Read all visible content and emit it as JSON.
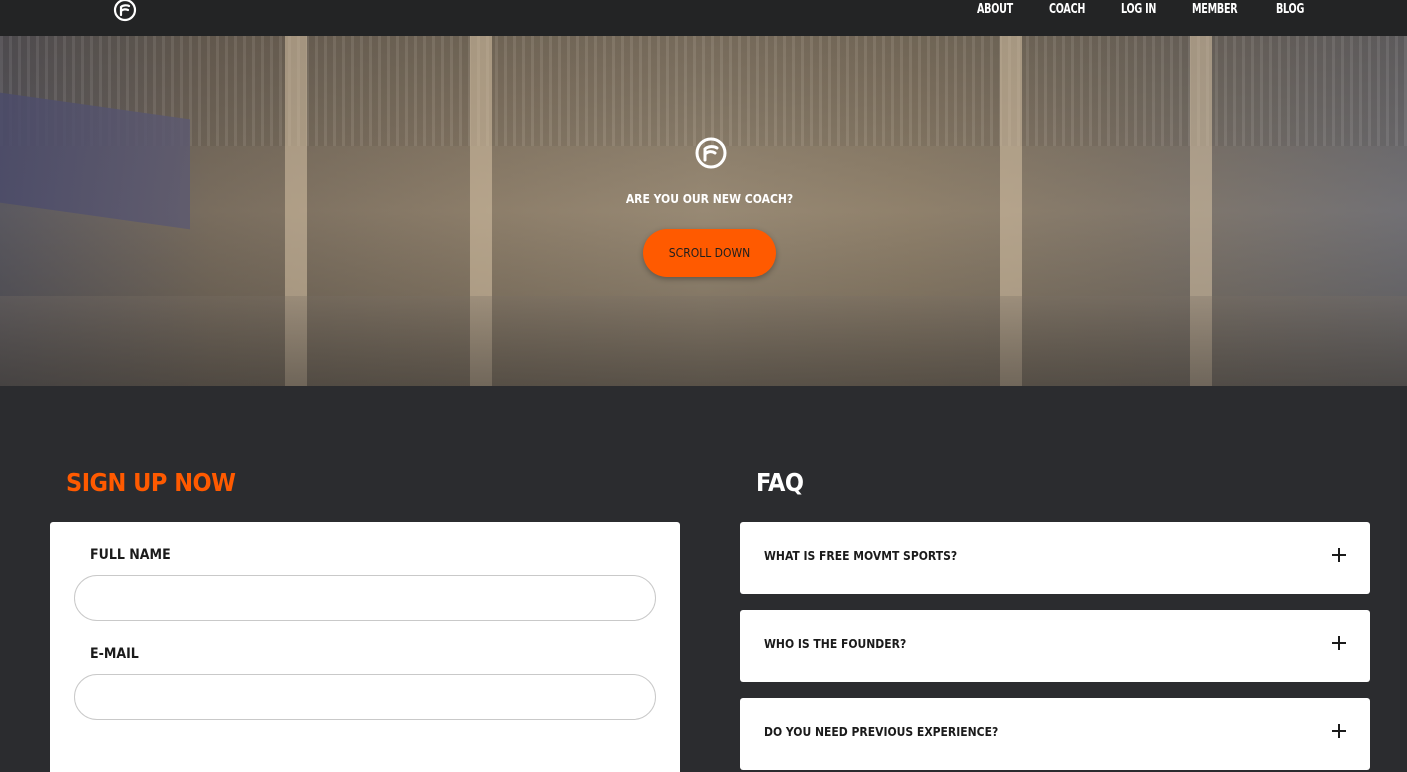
{
  "nav": {
    "items": [
      "ABOUT",
      "COACH",
      "LOG IN",
      "MEMBER",
      "BLOG"
    ]
  },
  "hero": {
    "title": "ARE YOU OUR NEW COACH?",
    "button_label": "SCROLL DOWN"
  },
  "signup": {
    "title": "SIGN UP NOW",
    "fields": [
      {
        "label": "FULL NAME",
        "value": "",
        "placeholder": ""
      },
      {
        "label": "E-MAIL",
        "value": "",
        "placeholder": ""
      }
    ]
  },
  "faq": {
    "title": "FAQ",
    "items": [
      {
        "question": "WHAT IS FREE MOVMT SPORTS?"
      },
      {
        "question": "WHO IS THE FOUNDER?"
      },
      {
        "question": "DO YOU NEED PREVIOUS EXPERIENCE?"
      }
    ]
  },
  "colors": {
    "accent": "#ff5a00",
    "background": "#2b2c2f",
    "topbar": "#232425",
    "card": "#ffffff"
  },
  "icons": {
    "logo": "brand-logo-icon",
    "faq_toggle": "plus-icon"
  }
}
